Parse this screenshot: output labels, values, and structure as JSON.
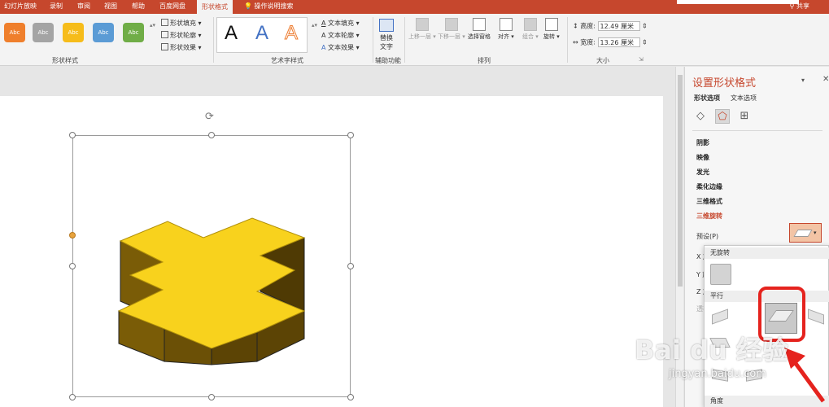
{
  "tabs": [
    {
      "label": "幻灯片放映"
    },
    {
      "label": "录制"
    },
    {
      "label": "审阅"
    },
    {
      "label": "视图"
    },
    {
      "label": "帮助"
    },
    {
      "label": "百度网盘"
    },
    {
      "label": "形状格式",
      "active": true
    }
  ],
  "tell_me": "操作说明搜索",
  "share": "共享",
  "ribbon": {
    "shape_styles": {
      "swatches": [
        {
          "label": "Abc",
          "color": "#ef7f2c"
        },
        {
          "label": "Abc",
          "color": "#a4a4a4"
        },
        {
          "label": "Abc",
          "color": "#f6bc1a"
        },
        {
          "label": "Abc",
          "color": "#5b9bd5"
        },
        {
          "label": "Abc",
          "color": "#70ad47"
        }
      ],
      "fill": "形状填充",
      "outline": "形状轮廓",
      "effects": "形状效果",
      "label": "形状样式"
    },
    "wordart": {
      "samples": [
        "A",
        "A",
        "A"
      ],
      "text_fill": "文本填充",
      "text_outline": "文本轮廓",
      "text_effects": "文本效果",
      "label": "艺术字样式"
    },
    "accessibility": {
      "alt_text_1": "替换",
      "alt_text_2": "文字",
      "label": "辅助功能"
    },
    "arrange": {
      "forward": "上移一层",
      "backward": "下移一层",
      "selection": "选择窗格",
      "align": "对齐",
      "group": "组合",
      "rotate": "旋转",
      "label": "排列"
    },
    "size": {
      "height_label": "高度:",
      "height": "12.49 厘米",
      "width_label": "宽度:",
      "width": "13.26 厘米",
      "label": "大小"
    }
  },
  "pane": {
    "title": "设置形状格式",
    "tab_shape": "形状选项",
    "tab_text": "文本选项",
    "sections": [
      "阴影",
      "映像",
      "发光",
      "柔化边缘",
      "三维格式",
      "三维旋转"
    ],
    "preset_label": "预设(P)",
    "side_labels": [
      "X 旋",
      "Y 旋",
      "Z 旋",
      "透视"
    ]
  },
  "gallery": {
    "no_rotation": "无旋转",
    "parallel": "平行",
    "angle": "角度"
  },
  "watermark": {
    "brand": "Bai du 经验",
    "url": "jingyan.baidu.com"
  },
  "colors": {
    "accent": "#c6472d",
    "cross": "#f8d21d",
    "highlight": "#e5231e"
  }
}
